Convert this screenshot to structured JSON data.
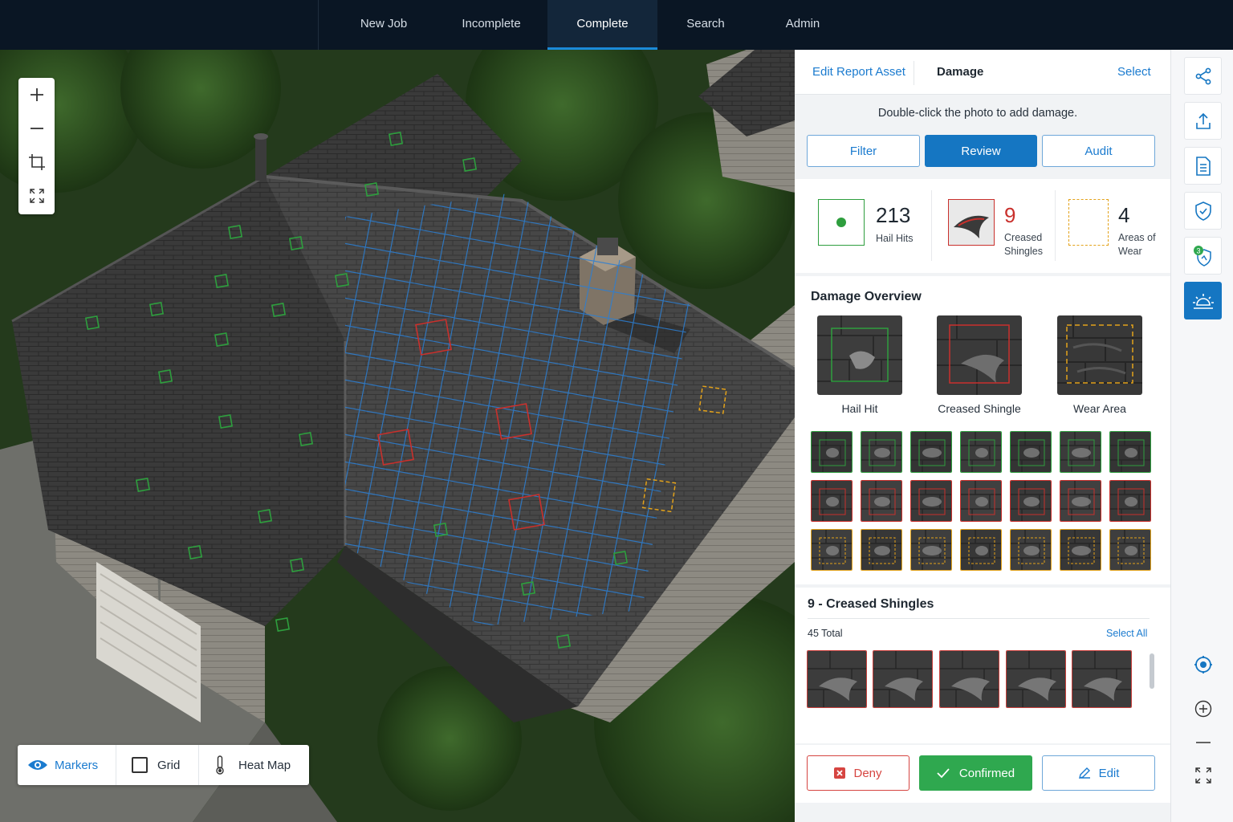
{
  "nav": {
    "tabs": [
      {
        "label": "New Job"
      },
      {
        "label": "Incomplete"
      },
      {
        "label": "Complete"
      },
      {
        "label": "Search"
      },
      {
        "label": "Admin"
      }
    ],
    "active": "Complete"
  },
  "layers": {
    "markers": "Markers",
    "grid": "Grid",
    "heat_map": "Heat Map"
  },
  "panel": {
    "header": {
      "edit_link": "Edit Report Asset",
      "section": "Damage",
      "select_link": "Select"
    },
    "instruction": "Double-click the photo to add damage.",
    "buttons": {
      "filter": "Filter",
      "review": "Review",
      "audit": "Audit"
    },
    "stats": [
      {
        "count": "213",
        "label_line1": "Hail Hits",
        "label_line2": "",
        "color": "#2e9e3e"
      },
      {
        "count": "9",
        "label_line1": "Creased",
        "label_line2": "Shingles",
        "color": "#c9302c"
      },
      {
        "count": "4",
        "label_line1": "Areas of",
        "label_line2": "Wear",
        "color": "#e3a21a"
      }
    ],
    "overview": {
      "title": "Damage Overview",
      "items": [
        {
          "label": "Hail Hit"
        },
        {
          "label": "Creased Shingle"
        },
        {
          "label": "Wear Area"
        }
      ]
    },
    "creased": {
      "title": "9 - Creased Shingles",
      "total": "45 Total",
      "select_all": "Select All"
    },
    "actions": {
      "deny": "Deny",
      "confirmed": "Confirmed",
      "edit": "Edit"
    }
  },
  "colors": {
    "accent_blue": "#1576c2",
    "hail_green": "#2e9e3e",
    "crease_red": "#c9302c",
    "wear_amber": "#e3a21a",
    "confirm_green": "#2fa84f"
  }
}
